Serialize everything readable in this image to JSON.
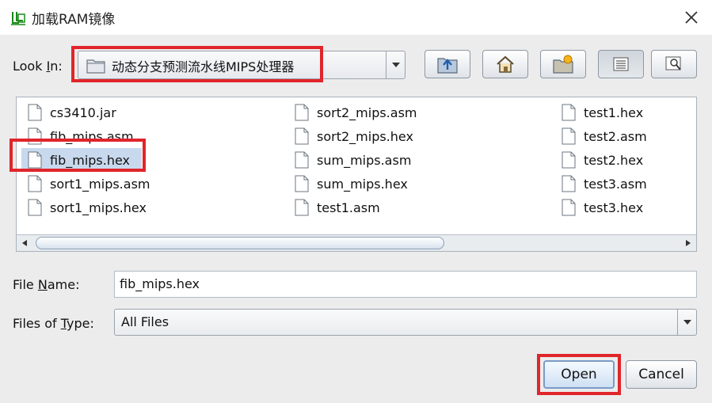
{
  "window": {
    "title": "加载RAM镜像",
    "app_icon": "jar-app-icon",
    "close_icon": "close-icon"
  },
  "look_in": {
    "label_pre": "Look ",
    "label_mnemonic": "I",
    "label_post": "n:",
    "value": "动态分支预测流水线MIPS处理器",
    "folder_icon": "folder-icon"
  },
  "toolbar": {
    "up_icon": "up-one-level-icon",
    "home_icon": "home-icon",
    "new_folder_icon": "new-folder-icon",
    "list_view_icon": "list-view-icon",
    "details_view_icon": "details-view-icon"
  },
  "files": {
    "columns": [
      [
        "cs3410.jar",
        "fib_mips.asm",
        "fib_mips.hex",
        "sort1_mips.asm",
        "sort1_mips.hex"
      ],
      [
        "sort2_mips.asm",
        "sort2_mips.hex",
        "sum_mips.asm",
        "sum_mips.hex",
        "test1.asm"
      ],
      [
        "test1.hex",
        "test2.asm",
        "test2.hex",
        "test3.asm",
        "test3.hex"
      ]
    ],
    "selected": "fib_mips.hex"
  },
  "file_name": {
    "label_pre": "File ",
    "label_mnemonic": "N",
    "label_post": "ame:",
    "value": "fib_mips.hex"
  },
  "file_type": {
    "label_pre": "Files of ",
    "label_mnemonic": "T",
    "label_post": "ype:",
    "value": "All Files"
  },
  "buttons": {
    "open": "Open",
    "cancel": "Cancel"
  },
  "colors": {
    "highlight": "#e0252b",
    "selection": "#c8d9ee"
  }
}
